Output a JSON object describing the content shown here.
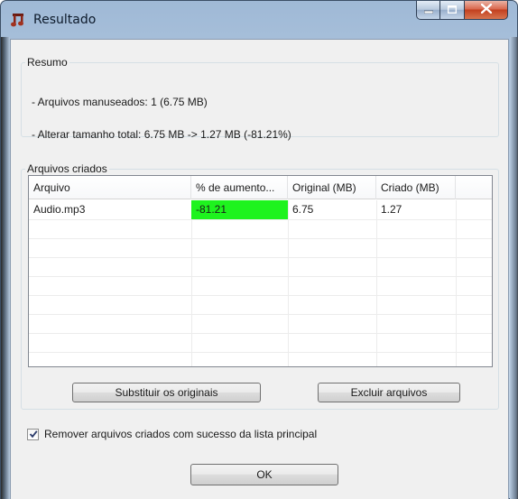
{
  "window": {
    "title": "Resultado",
    "minimize_glyph": "–",
    "maximize_glyph": "□",
    "close_glyph": "X"
  },
  "resumo": {
    "legend": "Resumo",
    "line1": "- Arquivos manuseados: 1  (6.75 MB)",
    "line2": "- Alterar tamanho total: 6.75 MB -> 1.27 MB  (-81.21%)"
  },
  "criados": {
    "legend": "Arquivos criados",
    "columns": [
      "Arquivo",
      "% de aumento...",
      "Original  (MB)",
      "Criado  (MB)"
    ],
    "rows": [
      {
        "arquivo": "Audio.mp3",
        "aumento": "-81.21",
        "original": "6.75",
        "criado": "1.27",
        "highlight": "#1ef31e"
      }
    ]
  },
  "buttons": {
    "substituir": "Substituir os originais",
    "excluir": "Excluir arquivos",
    "ok": "OK"
  },
  "checkbox": {
    "label": "Remover arquivos criados com sucesso da lista principal",
    "checked": true
  },
  "colors": {
    "accent_frame": "#b9cde3",
    "close_button": "#c2401f",
    "positive_cell": "#1ef31e"
  }
}
